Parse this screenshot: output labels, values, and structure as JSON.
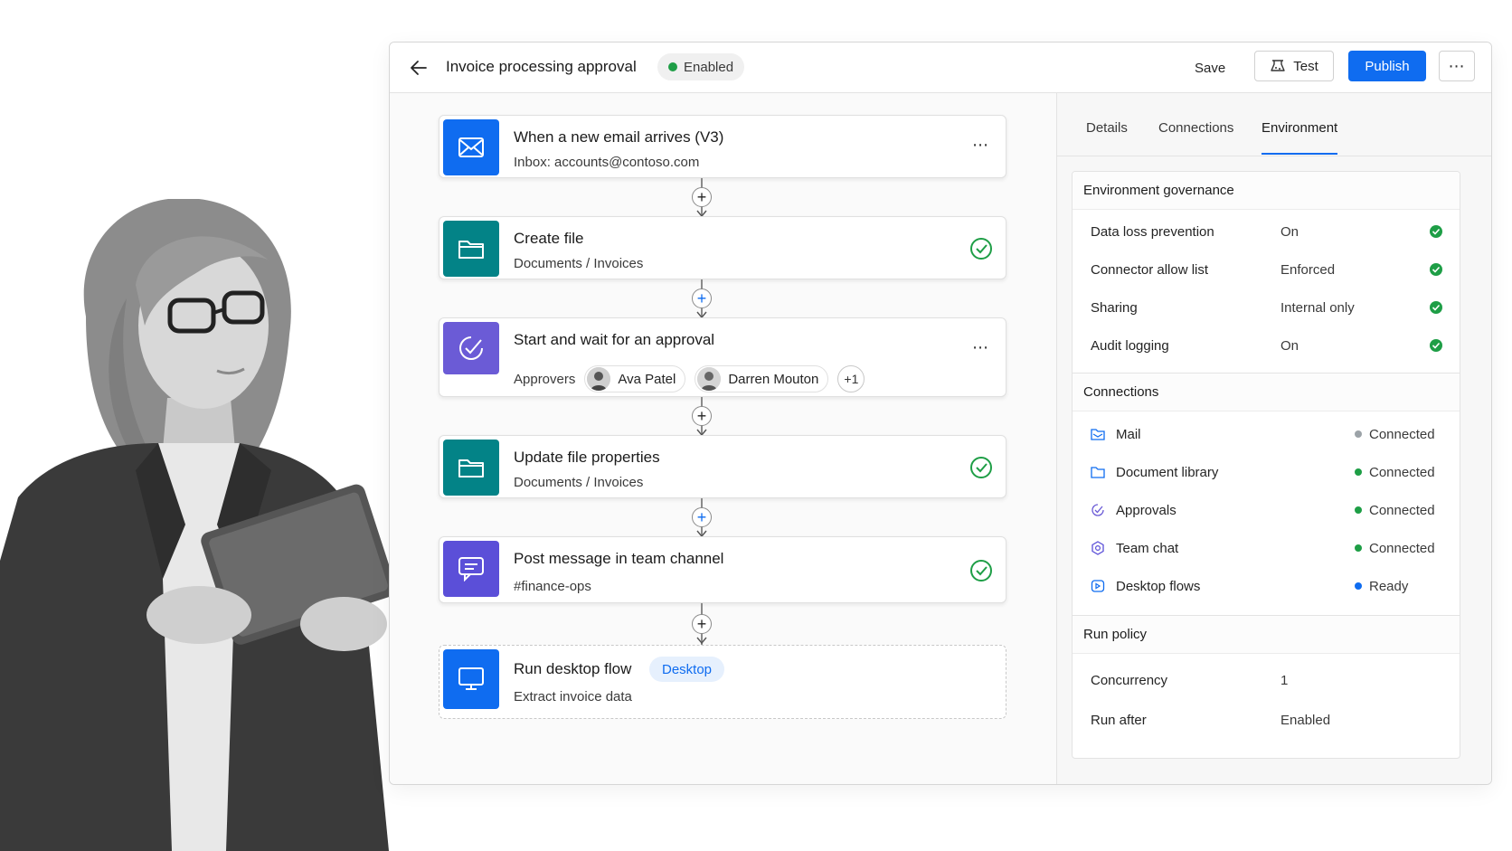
{
  "header": {
    "title": "Invoice processing approval",
    "status": "Enabled",
    "save_label": "Save",
    "test_label": "Test",
    "publish_label": "Publish"
  },
  "flow": {
    "steps": [
      {
        "title": "When a new email arrives (V3)",
        "subtitle": "Inbox: accounts@contoso.com",
        "icon": "mail-icon",
        "color": "#0f6cf0"
      },
      {
        "title": "Create file",
        "subtitle": "Documents / Invoices",
        "icon": "folder-icon",
        "color": "#038387"
      },
      {
        "title": "Start and wait for an approval",
        "approvers_label": "Approvers",
        "approvers": [
          "Ava Patel",
          "Darren Mouton"
        ],
        "more": "+1",
        "icon": "approval-icon",
        "color": "#6b5bd6"
      },
      {
        "title": "Update file properties",
        "subtitle": "Documents / Invoices",
        "icon": "folder-icon",
        "color": "#038387"
      },
      {
        "title": "Post message in team channel",
        "subtitle": "#finance-ops",
        "icon": "chat-icon",
        "color": "#5b4fd8"
      },
      {
        "title": "Run desktop flow",
        "tag": "Desktop",
        "subtitle": "Extract invoice data",
        "icon": "monitor-icon",
        "color": "#0f6cf0"
      }
    ]
  },
  "panel": {
    "tabs": [
      "Details",
      "Connections",
      "Environment"
    ],
    "active_tab": "Environment",
    "governance": {
      "title": "Environment governance",
      "rows": [
        {
          "label": "Data loss prevention",
          "value": "On"
        },
        {
          "label": "Connector allow list",
          "value": "Enforced"
        },
        {
          "label": "Sharing",
          "value": "Internal only"
        },
        {
          "label": "Audit logging",
          "value": "On"
        }
      ]
    },
    "connections": {
      "title": "Connections",
      "rows": [
        {
          "label": "Mail",
          "status": "Connected",
          "dot": "#9ca3a8"
        },
        {
          "label": "Document library",
          "status": "Connected",
          "dot": "#1e9e46"
        },
        {
          "label": "Approvals",
          "status": "Connected",
          "dot": "#1e9e46"
        },
        {
          "label": "Team chat",
          "status": "Connected",
          "dot": "#1e9e46"
        },
        {
          "label": "Desktop flows",
          "status": "Ready",
          "dot": "#0f6cf0"
        }
      ]
    },
    "run_policy": {
      "title": "Run policy",
      "rows": [
        {
          "label": "Concurrency",
          "value": "1"
        },
        {
          "label": "Run after",
          "value": "Enabled"
        }
      ]
    }
  },
  "colors": {
    "accent": "#0f6cf0",
    "success": "#1e9e46"
  }
}
